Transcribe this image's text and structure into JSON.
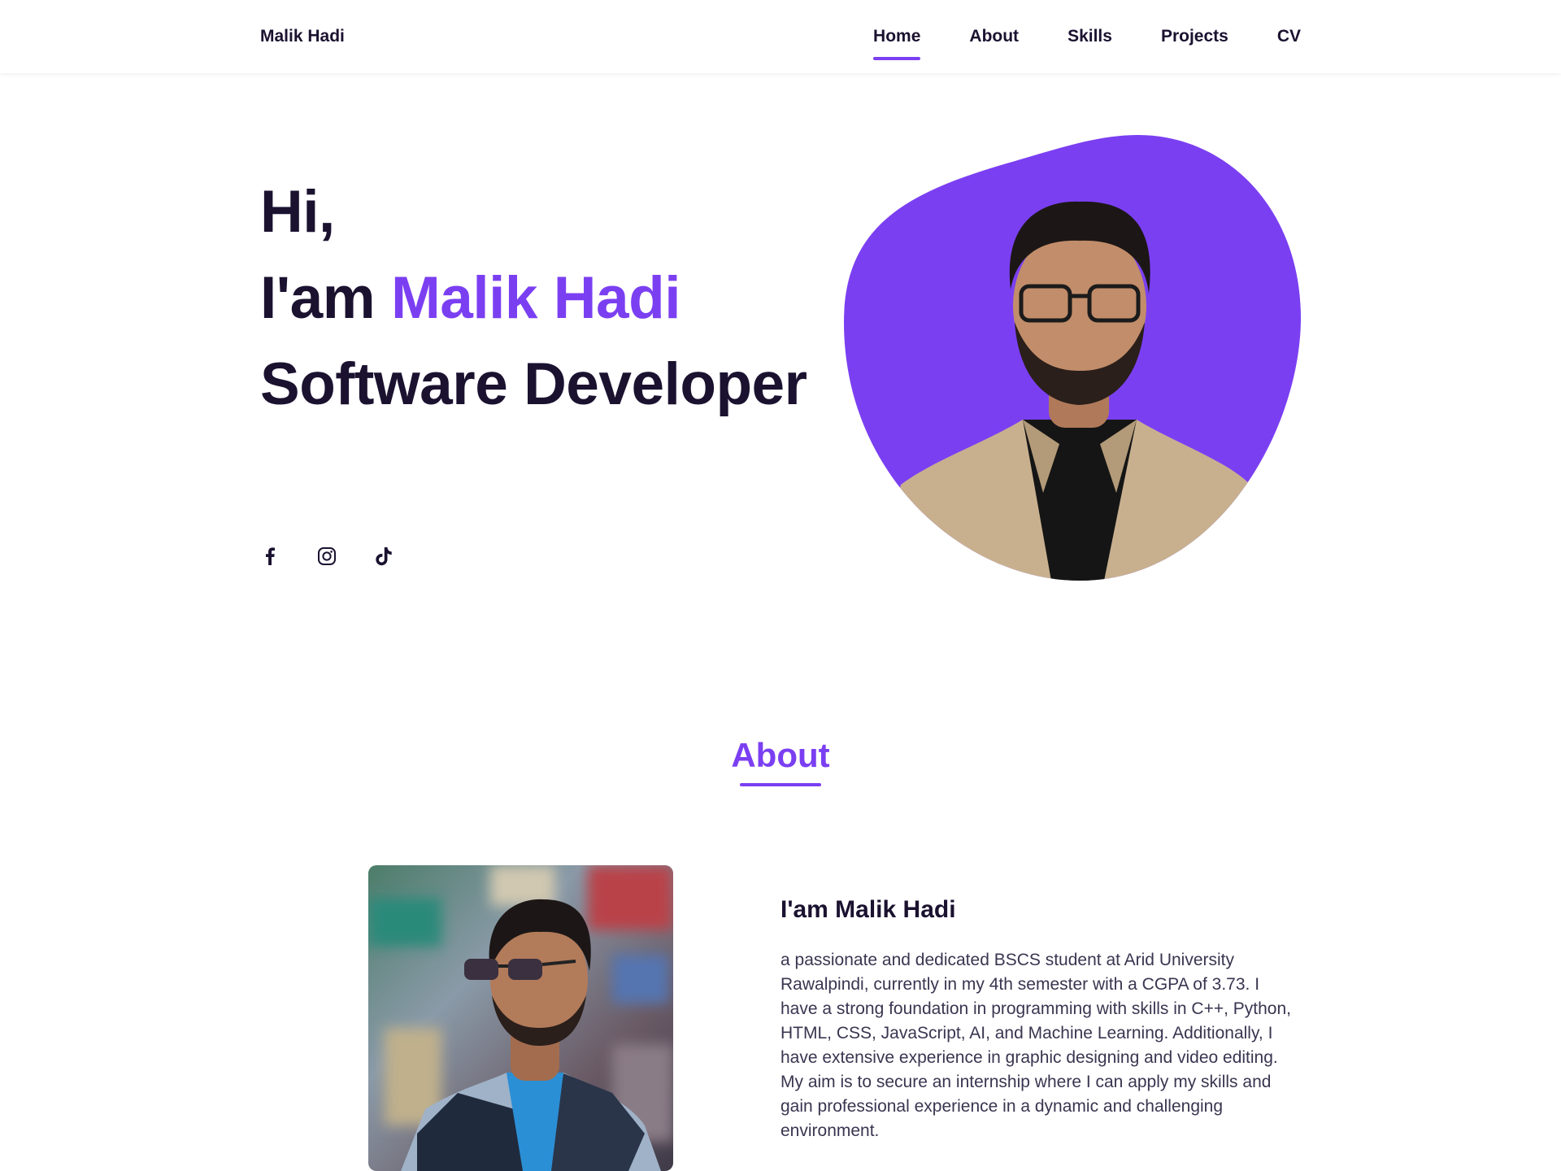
{
  "header": {
    "logo": "Malik Hadi",
    "nav": [
      {
        "label": "Home",
        "active": true
      },
      {
        "label": "About",
        "active": false
      },
      {
        "label": "Skills",
        "active": false
      },
      {
        "label": "Projects",
        "active": false
      },
      {
        "label": "CV",
        "active": false
      }
    ]
  },
  "hero": {
    "line1": "Hi,",
    "line2_prefix": "I'am ",
    "line2_name": "Malik Hadi",
    "line3": "Software Developer",
    "social_icons": [
      "facebook-icon",
      "instagram-icon",
      "tiktok-icon"
    ]
  },
  "about": {
    "title": "About",
    "heading": "I'am Malik Hadi",
    "description": "a passionate and dedicated BSCS student at Arid University Rawalpindi, currently in my 4th semester with a CGPA of 3.73. I have a strong foundation in programming with skills in C++, Python, HTML, CSS, JavaScript, AI, and Machine Learning. Additionally, I have extensive experience in graphic designing and video editing. My aim is to secure an internship where I can apply my skills and gain professional experience in a dynamic and challenging environment."
  },
  "colors": {
    "accent": "#7b3ff2",
    "text": "#1b1230"
  }
}
